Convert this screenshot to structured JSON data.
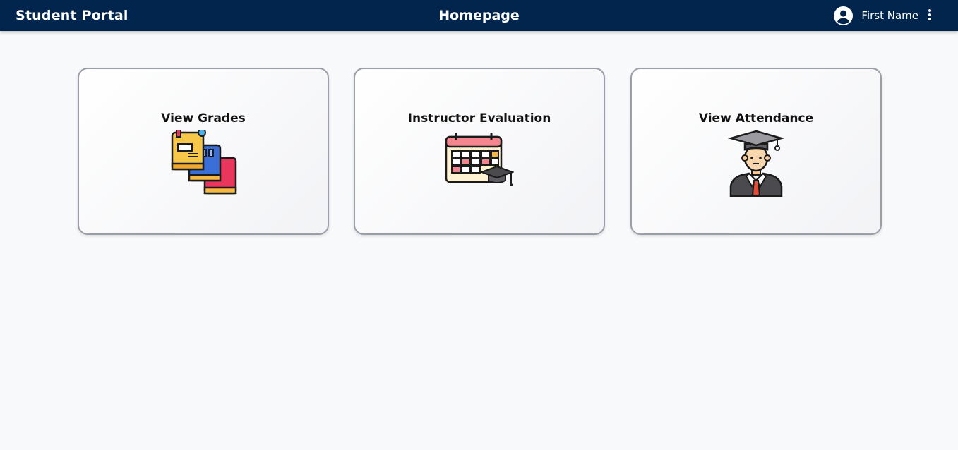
{
  "header": {
    "app_title": "Student Portal",
    "page_title": "Homepage",
    "user_name": "First Name",
    "background_color": "#02254d"
  },
  "cards": [
    {
      "label": "View Grades",
      "icon": "books-icon"
    },
    {
      "label": "Instructor Evaluation",
      "icon": "calendar-graduation-icon"
    },
    {
      "label": "View Attendance",
      "icon": "graduate-student-icon"
    }
  ]
}
